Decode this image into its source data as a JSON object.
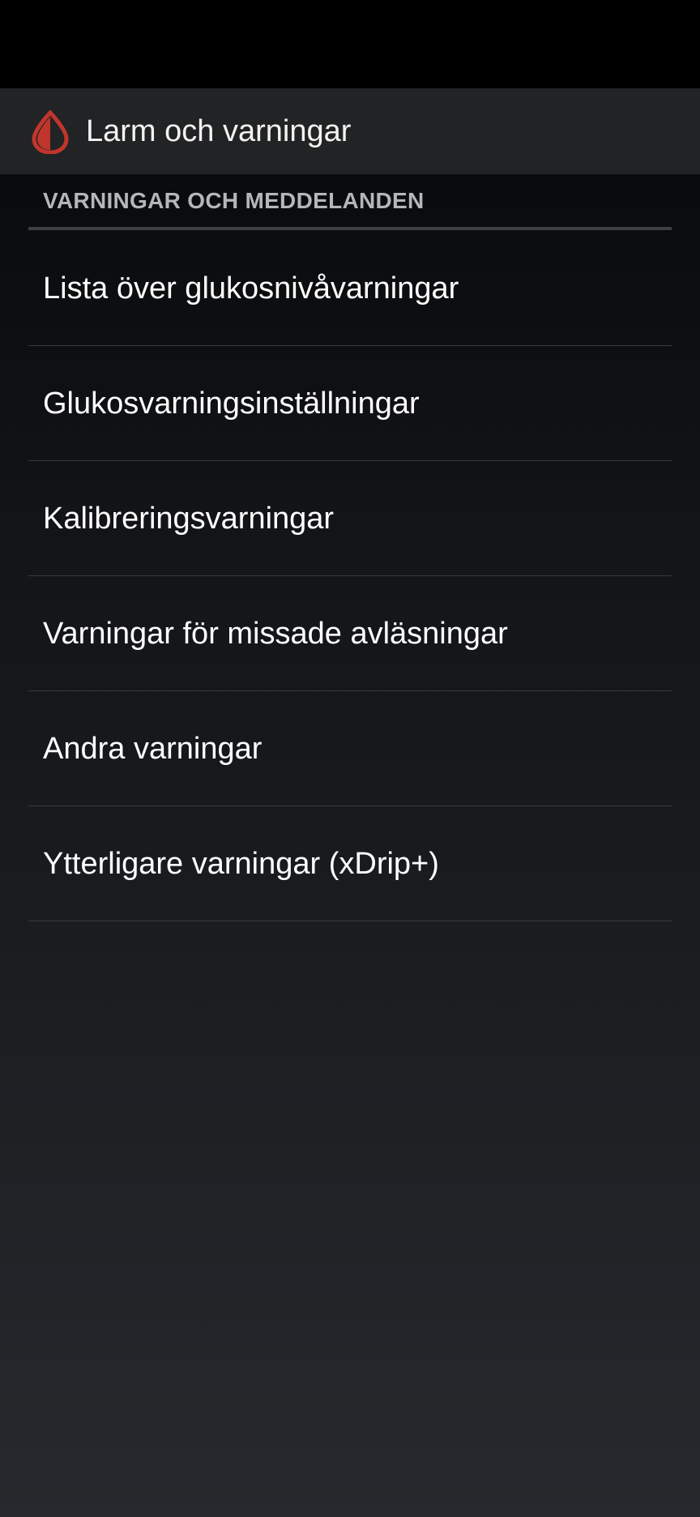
{
  "app_bar": {
    "icon": "blood-drop-icon",
    "icon_color": "#c0362c",
    "title": "Larm och varningar"
  },
  "section": {
    "header": "VARNINGAR OCH MEDDELANDEN"
  },
  "menu": {
    "items": [
      {
        "label": "Lista över glukosnivåvarningar"
      },
      {
        "label": "Glukosvarningsinställningar"
      },
      {
        "label": "Kalibreringsvarningar"
      },
      {
        "label": "Varningar för missade avläsningar"
      },
      {
        "label": "Andra varningar"
      },
      {
        "label": "Ytterligare varningar (xDrip+)"
      }
    ]
  }
}
